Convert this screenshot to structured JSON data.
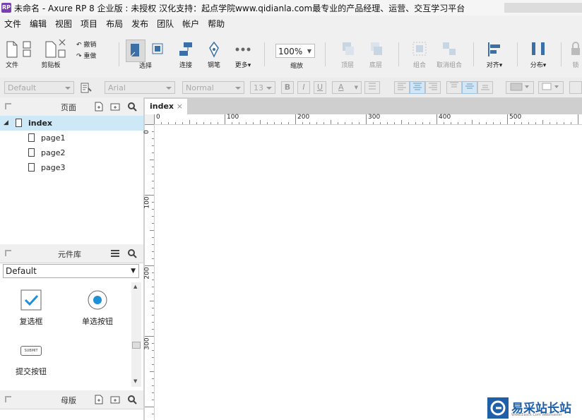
{
  "window": {
    "title": "未命名 - Axure RP 8 企业版 : 未授权 汉化支持：起点学院www.qidianla.com最专业的产品经理、运营、交互学习平台",
    "app_icon": "RP"
  },
  "menu": [
    "文件",
    "编辑",
    "视图",
    "项目",
    "布局",
    "发布",
    "团队",
    "帐户",
    "帮助"
  ],
  "toolbar": {
    "file": "文件",
    "clipboard": "剪贴板",
    "undo": "撤销",
    "redo": "重做",
    "select": "选择",
    "connect": "连接",
    "pen": "钢笔",
    "more": "更多▾",
    "zoom_value": "100%",
    "zoom": "缩放",
    "top": "顶层",
    "bottom": "底层",
    "group": "组合",
    "ungroup": "取消组合",
    "align": "对齐▾",
    "distribute": "分布▾",
    "lock": "锁"
  },
  "format": {
    "style": "Default",
    "font": "Arial",
    "weight": "Normal",
    "size": "13",
    "bold": "B",
    "italic": "I",
    "underline": "U",
    "font_color": "A"
  },
  "pages_panel": {
    "title": "页面",
    "items": [
      {
        "label": "index",
        "selected": true
      },
      {
        "label": "page1"
      },
      {
        "label": "page2"
      },
      {
        "label": "page3"
      }
    ]
  },
  "library_panel": {
    "title": "元件库",
    "selected_library": "Default",
    "widgets": [
      {
        "label": "复选框",
        "icon": "checkbox-icon"
      },
      {
        "label": "单选按钮",
        "icon": "radio-icon"
      },
      {
        "label": "提交按钮",
        "icon": "submit-button-icon",
        "icon_text": "SUBMIT"
      }
    ]
  },
  "masters_panel": {
    "title": "母版"
  },
  "canvas": {
    "tab": "index",
    "tab_close": "×",
    "h_ticks": [
      "0",
      "100",
      "200",
      "300",
      "400",
      "500"
    ],
    "v_ticks": [
      "0",
      "100",
      "200",
      "300"
    ]
  },
  "watermark": {
    "text": "易采站长站",
    "sub": "Www.Easck.Com Webmaster"
  },
  "colors": {
    "accent": "#1f8fd6",
    "selected_row": "#cde8f7",
    "purple": "#7a3fb3"
  }
}
